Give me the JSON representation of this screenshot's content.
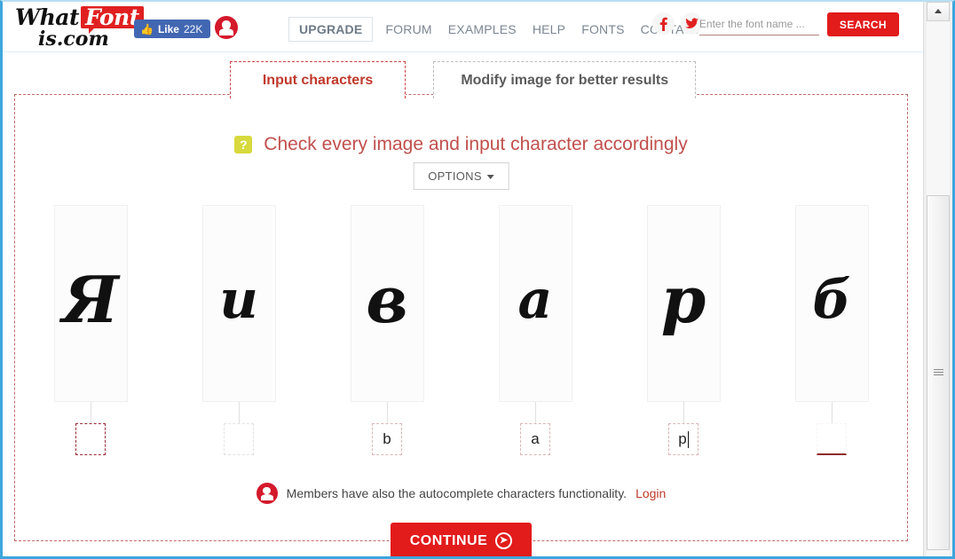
{
  "browser": {
    "scrollbar": {
      "up_arrow_icon": "triangle-up-icon",
      "grip_icon": "scrollbar-grip-icon"
    }
  },
  "header": {
    "logo": {
      "part1": "What",
      "part2": "Font",
      "part3": "is.com"
    },
    "facebook_like": {
      "icon": "thumbs-up-icon",
      "label": "Like",
      "count": "22K"
    },
    "account_icon": "user-avatar-icon",
    "nav": [
      {
        "label": "UPGRADE",
        "highlighted": true
      },
      {
        "label": "FORUM",
        "highlighted": false
      },
      {
        "label": "EXAMPLES",
        "highlighted": false
      },
      {
        "label": "HELP",
        "highlighted": false
      },
      {
        "label": "FONTS",
        "highlighted": false
      },
      {
        "label": "CONTACT",
        "highlighted": false
      }
    ],
    "social": [
      {
        "name": "facebook-icon",
        "glyph": "f"
      },
      {
        "name": "twitter-icon",
        "glyph": "t"
      }
    ],
    "search": {
      "placeholder": "Enter the font name ...",
      "value": "",
      "button_label": "SEARCH"
    }
  },
  "tabs": [
    {
      "label": "Input characters",
      "active": true
    },
    {
      "label": "Modify image for better results",
      "active": false
    }
  ],
  "panel": {
    "help_badge": "?",
    "heading": "Check every image and input character accordingly",
    "options_button": "OPTIONS",
    "glyphs": [
      {
        "image_char": "Я",
        "input_value": "",
        "state": "focus-strong",
        "caret": false
      },
      {
        "image_char": "и",
        "input_value": "",
        "state": "dim",
        "caret": false
      },
      {
        "image_char": "в",
        "input_value": "b",
        "state": "normal",
        "caret": false
      },
      {
        "image_char": "а",
        "input_value": "a",
        "state": "normal",
        "caret": false
      },
      {
        "image_char": "р",
        "input_value": "p",
        "state": "normal",
        "caret": true
      },
      {
        "image_char": "б",
        "input_value": "",
        "state": "underline-only",
        "caret": false
      }
    ],
    "members_note": {
      "avatar_icon": "user-avatar-icon",
      "text": "Members have also the autocomplete characters functionality.",
      "link_label": "Login"
    },
    "continue_button": {
      "label": "CONTINUE",
      "icon": "arrow-right-circle-icon"
    }
  },
  "colors": {
    "brand_red": "#e21b1b",
    "accent_dark_red": "#c0392b",
    "help_yellow": "#d7d93c",
    "facebook_blue": "#4267b2",
    "window_blue": "#3ea6dd"
  }
}
